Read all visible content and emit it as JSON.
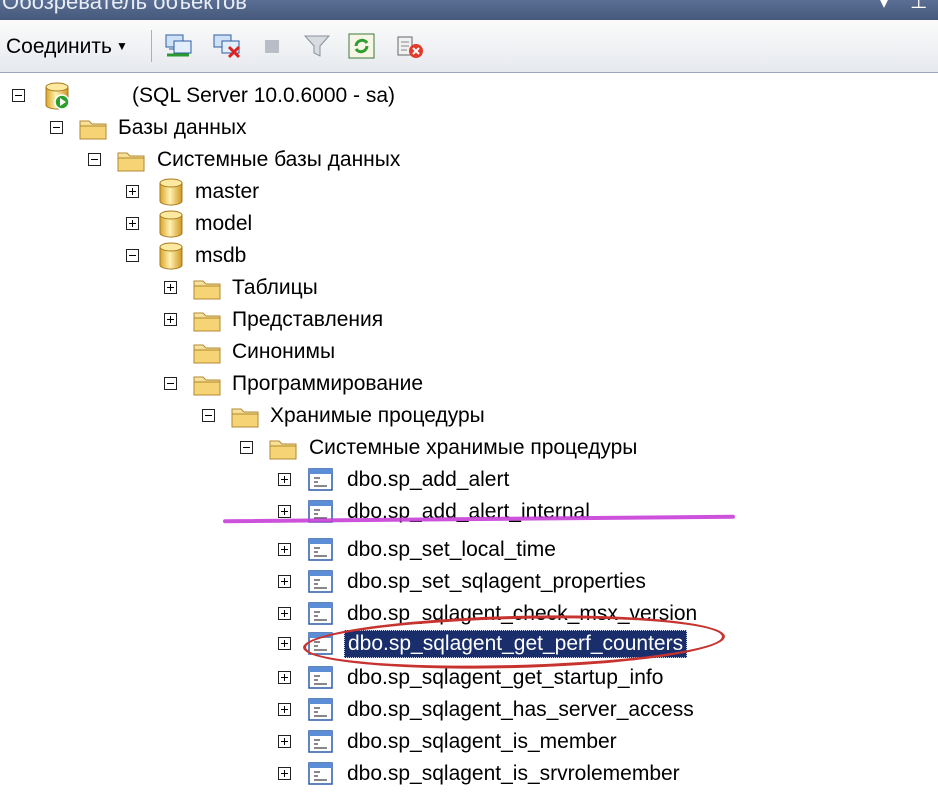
{
  "window": {
    "title": "Обозреватель объектов"
  },
  "toolbar": {
    "connect_label": "Соединить"
  },
  "tree": {
    "server": "(SQL Server 10.0.6000 - sa)",
    "databases": "Базы данных",
    "system_databases": "Системные базы данных",
    "master": "master",
    "model": "model",
    "msdb": "msdb",
    "tables": "Таблицы",
    "views": "Представления",
    "synonyms": "Синонимы",
    "programmability": "Программирование",
    "stored_procedures": "Хранимые процедуры",
    "system_stored_procedures": "Системные хранимые процедуры",
    "procs": [
      "dbo.sp_add_alert",
      "dbo.sp_add_alert_internal",
      "dbo.sp_set_local_time",
      "dbo.sp_set_sqlagent_properties",
      "dbo.sp_sqlagent_check_msx_version",
      "dbo.sp_sqlagent_get_perf_counters",
      "dbo.sp_sqlagent_get_startup_info",
      "dbo.sp_sqlagent_has_server_access",
      "dbo.sp_sqlagent_is_member",
      "dbo.sp_sqlagent_is_srvrolemember"
    ],
    "selected_proc_index": 5
  },
  "colors": {
    "selection": "#1a2e6c",
    "annotation_underline": "#c73fd8",
    "annotation_circle": "#c7332f"
  }
}
